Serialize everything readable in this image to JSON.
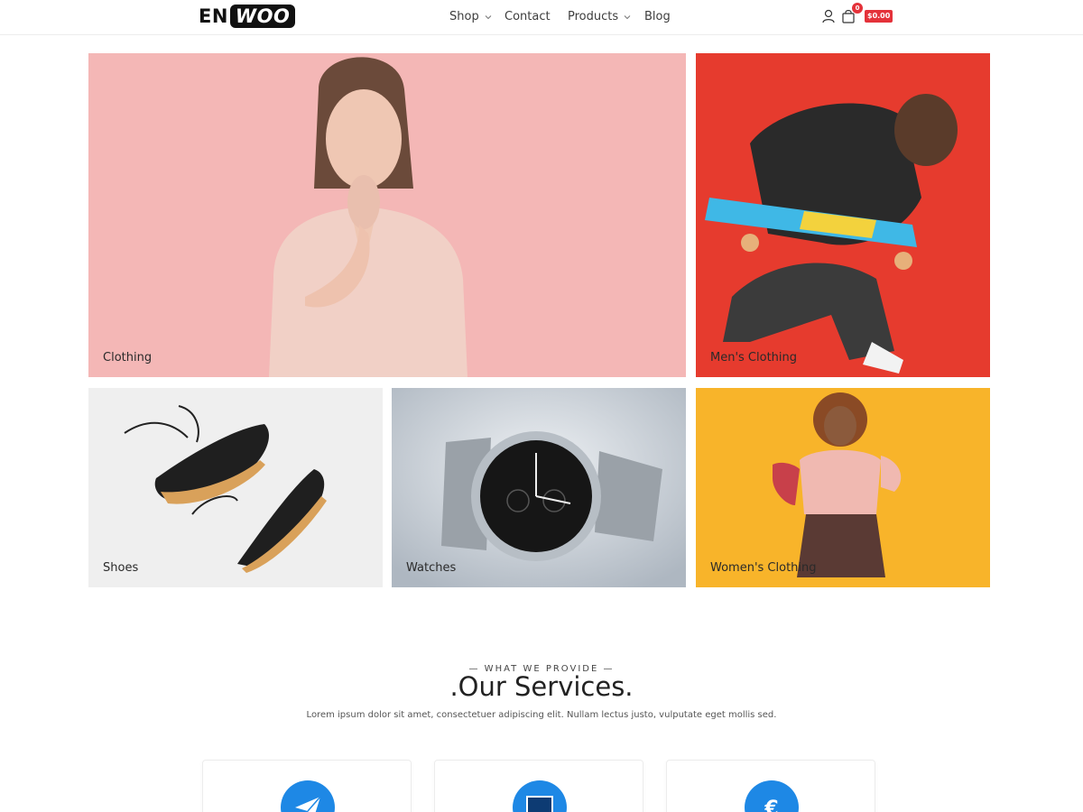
{
  "brand": {
    "logo_left": "EN",
    "logo_right": "WOO"
  },
  "nav": {
    "items": [
      {
        "label": "Shop",
        "has_dropdown": true
      },
      {
        "label": "Contact",
        "has_dropdown": false
      },
      {
        "label": "Products",
        "has_dropdown": true
      },
      {
        "label": "Blog",
        "has_dropdown": false
      }
    ]
  },
  "header_icons": {
    "account_icon": "user-icon",
    "cart_icon": "cart-icon",
    "cart_count": "0",
    "cart_total": "$0.00"
  },
  "categories": [
    {
      "label": "Clothing",
      "bg": "#f3b5b4"
    },
    {
      "label": "Men's Clothing",
      "bg": "#e93a2c"
    },
    {
      "label": "Shoes",
      "bg": "#eeeeee"
    },
    {
      "label": "Watches",
      "bg": "#cfd6de"
    },
    {
      "label": "Women's Clothing",
      "bg": "#f7b52e"
    }
  ],
  "services": {
    "eyebrow": "— WHAT WE PROVIDE —",
    "title": ".Our Services.",
    "subtitle": "Lorem ipsum dolor sit amet, consectetuer adipiscing elit. Nullam lectus justo, vulputate eget mollis sed.",
    "cards": [
      {
        "icon": "paper-plane-icon"
      },
      {
        "icon": "monitor-icon"
      },
      {
        "icon": "euro-icon"
      }
    ],
    "accent": "#1e88e5"
  }
}
